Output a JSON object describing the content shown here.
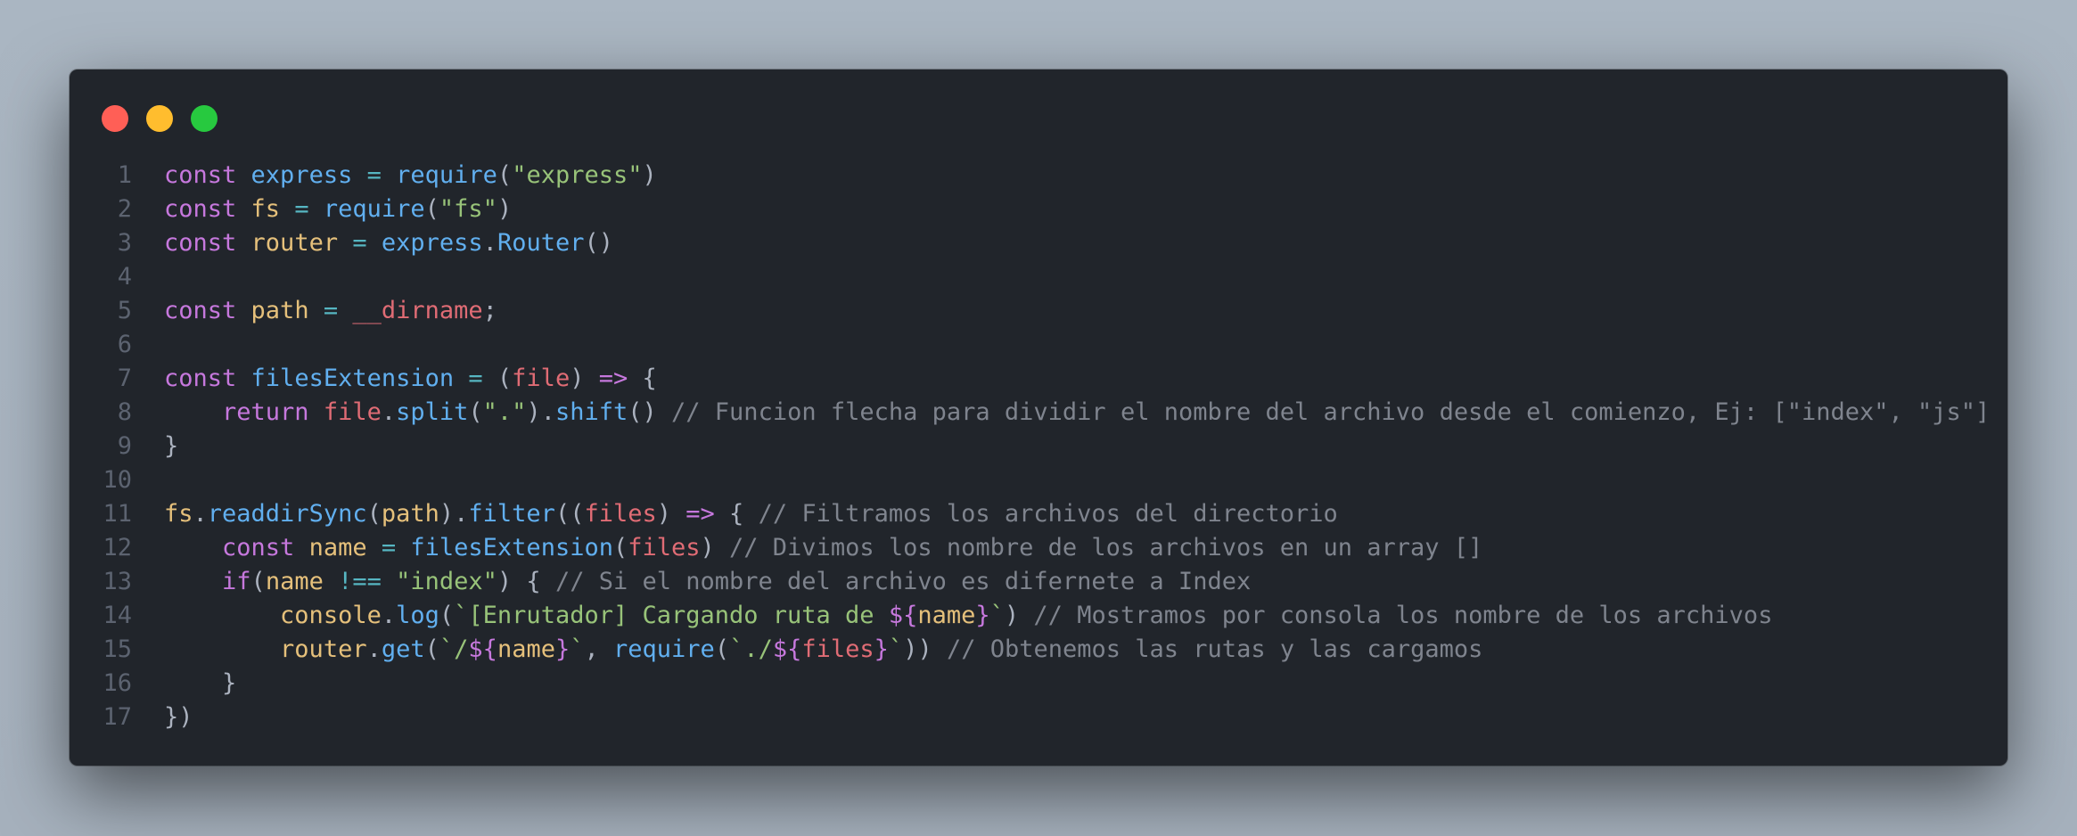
{
  "window": {
    "controls": [
      "close",
      "minimize",
      "maximize"
    ],
    "colors": {
      "background": "#21252b",
      "close": "#ff5f56",
      "minimize": "#ffbd2e",
      "maximize": "#27c93f"
    }
  },
  "code": {
    "language": "javascript",
    "lines": [
      {
        "n": "1",
        "tokens": [
          [
            "kw",
            "const "
          ],
          [
            "fn",
            "express"
          ],
          [
            "op",
            " = "
          ],
          [
            "fn",
            "require"
          ],
          [
            "pun",
            "("
          ],
          [
            "str",
            "\"express\""
          ],
          [
            "pun",
            ")"
          ]
        ]
      },
      {
        "n": "2",
        "tokens": [
          [
            "kw",
            "const "
          ],
          [
            "var",
            "fs"
          ],
          [
            "op",
            " = "
          ],
          [
            "fn",
            "require"
          ],
          [
            "pun",
            "("
          ],
          [
            "str",
            "\"fs\""
          ],
          [
            "pun",
            ")"
          ]
        ]
      },
      {
        "n": "3",
        "tokens": [
          [
            "kw",
            "const "
          ],
          [
            "var",
            "router"
          ],
          [
            "op",
            " = "
          ],
          [
            "fn",
            "express"
          ],
          [
            "pun",
            "."
          ],
          [
            "fn",
            "Router"
          ],
          [
            "pun",
            "()"
          ]
        ]
      },
      {
        "n": "4",
        "tokens": []
      },
      {
        "n": "5",
        "tokens": [
          [
            "kw",
            "const "
          ],
          [
            "var",
            "path"
          ],
          [
            "op",
            " = "
          ],
          [
            "err",
            "__dirname"
          ],
          [
            "pun",
            ";"
          ]
        ]
      },
      {
        "n": "6",
        "tokens": []
      },
      {
        "n": "7",
        "tokens": [
          [
            "kw",
            "const "
          ],
          [
            "fn",
            "filesExtension"
          ],
          [
            "op",
            " = "
          ],
          [
            "pun",
            "("
          ],
          [
            "err",
            "file"
          ],
          [
            "pun",
            ") "
          ],
          [
            "kw",
            "=>"
          ],
          [
            "pun",
            " {"
          ]
        ]
      },
      {
        "n": "8",
        "tokens": [
          [
            "pun",
            "    "
          ],
          [
            "kw",
            "return "
          ],
          [
            "err",
            "file"
          ],
          [
            "pun",
            "."
          ],
          [
            "fn",
            "split"
          ],
          [
            "pun",
            "("
          ],
          [
            "str",
            "\".\""
          ],
          [
            "pun",
            ")."
          ],
          [
            "fn",
            "shift"
          ],
          [
            "pun",
            "() "
          ],
          [
            "com",
            "// Funcion flecha para dividir el nombre del archivo desde el comienzo, Ej: [\"index\", \"js\"]"
          ]
        ]
      },
      {
        "n": "9",
        "tokens": [
          [
            "pun",
            "}"
          ]
        ]
      },
      {
        "n": "10",
        "tokens": []
      },
      {
        "n": "11",
        "tokens": [
          [
            "var",
            "fs"
          ],
          [
            "pun",
            "."
          ],
          [
            "fn",
            "readdirSync"
          ],
          [
            "pun",
            "("
          ],
          [
            "var",
            "path"
          ],
          [
            "pun",
            ")."
          ],
          [
            "fn",
            "filter"
          ],
          [
            "pun",
            "(("
          ],
          [
            "err",
            "files"
          ],
          [
            "pun",
            ") "
          ],
          [
            "kw",
            "=>"
          ],
          [
            "pun",
            " { "
          ],
          [
            "com",
            "// Filtramos los archivos del directorio"
          ]
        ]
      },
      {
        "n": "12",
        "tokens": [
          [
            "pun",
            "    "
          ],
          [
            "kw",
            "const "
          ],
          [
            "var",
            "name"
          ],
          [
            "op",
            " = "
          ],
          [
            "fn",
            "filesExtension"
          ],
          [
            "pun",
            "("
          ],
          [
            "err",
            "files"
          ],
          [
            "pun",
            ") "
          ],
          [
            "com",
            "// Divimos los nombre de los archivos en un array []"
          ]
        ]
      },
      {
        "n": "13",
        "tokens": [
          [
            "pun",
            "    "
          ],
          [
            "kw",
            "if"
          ],
          [
            "pun",
            "("
          ],
          [
            "var",
            "name"
          ],
          [
            "op",
            " !== "
          ],
          [
            "str",
            "\"index\""
          ],
          [
            "pun",
            ") { "
          ],
          [
            "com",
            "// Si el nombre del archivo es difernete a Index"
          ]
        ]
      },
      {
        "n": "14",
        "tokens": [
          [
            "pun",
            "        "
          ],
          [
            "var",
            "console"
          ],
          [
            "pun",
            "."
          ],
          [
            "fn",
            "log"
          ],
          [
            "pun",
            "("
          ],
          [
            "str",
            "`[Enrutador] Cargando ruta de "
          ],
          [
            "kw",
            "${"
          ],
          [
            "var",
            "name"
          ],
          [
            "kw",
            "}"
          ],
          [
            "str",
            "`"
          ],
          [
            "pun",
            ") "
          ],
          [
            "com",
            "// Mostramos por consola los nombre de los archivos"
          ]
        ]
      },
      {
        "n": "15",
        "tokens": [
          [
            "pun",
            "        "
          ],
          [
            "var",
            "router"
          ],
          [
            "pun",
            "."
          ],
          [
            "fn",
            "get"
          ],
          [
            "pun",
            "("
          ],
          [
            "str",
            "`/"
          ],
          [
            "kw",
            "${"
          ],
          [
            "var",
            "name"
          ],
          [
            "kw",
            "}"
          ],
          [
            "str",
            "`"
          ],
          [
            "pun",
            ", "
          ],
          [
            "fn",
            "require"
          ],
          [
            "pun",
            "("
          ],
          [
            "str",
            "`./"
          ],
          [
            "kw",
            "${"
          ],
          [
            "err",
            "files"
          ],
          [
            "kw",
            "}"
          ],
          [
            "str",
            "`"
          ],
          [
            "pun",
            "))"
          ],
          [
            "com",
            " // Obtenemos las rutas y las cargamos"
          ]
        ]
      },
      {
        "n": "16",
        "tokens": [
          [
            "pun",
            "    }"
          ]
        ]
      },
      {
        "n": "17",
        "tokens": [
          [
            "pun",
            "})"
          ]
        ]
      }
    ]
  }
}
